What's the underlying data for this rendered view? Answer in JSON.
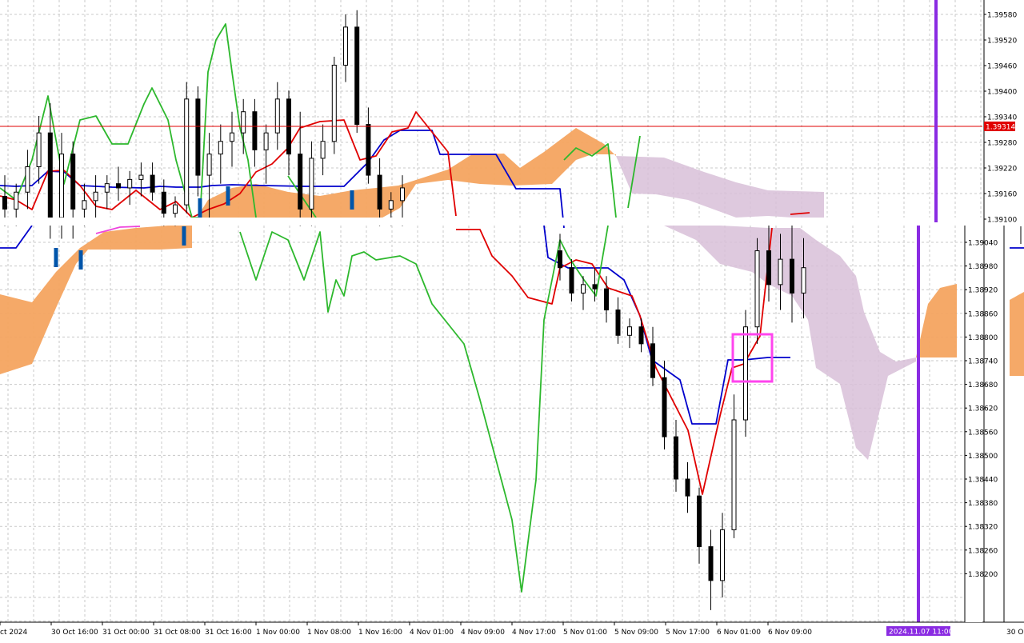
{
  "chart_data": {
    "type": "candlestick",
    "title": "",
    "ylim": [
      1.3816,
      1.3961
    ],
    "y_ticks": [
      "1.39580",
      "1.39520",
      "1.39460",
      "1.39400",
      "1.39340",
      "1.39280",
      "1.39220",
      "1.39160",
      "1.39100",
      "1.39040",
      "1.38980",
      "1.38920",
      "1.38860",
      "1.38800",
      "1.38740",
      "1.38680",
      "1.38620",
      "1.38560",
      "1.38500",
      "1.38440",
      "1.38380",
      "1.38320",
      "1.38260",
      "1.38200"
    ],
    "x_ticks": [
      "ct 2024",
      "30 Oct 16:00",
      "31 Oct 00:00",
      "31 Oct 08:00",
      "31 Oct 16:00",
      "1 Nov 00:00",
      "1 Nov 08:00",
      "1 Nov 16:00",
      "4 Nov 01:00",
      "4 Nov 09:00",
      "4 Nov 17:00",
      "5 Nov 01:00",
      "5 Nov 09:00",
      "5 Nov 17:00",
      "6 Nov 01:00",
      "6 Nov 09:00"
    ],
    "right_panel_tick": "30 O",
    "current_price": "1.39314",
    "vline_label": "2024.11.07 11:00",
    "grid": true,
    "colors": {
      "bull_candle": "#000000",
      "bear_candle": "#000000",
      "tenkan": "#e00000",
      "kijun": "#0000cc",
      "chikou": "#2db82d",
      "kumo_up": "#f4a460",
      "kumo_down": "#d8bfd8",
      "price_line": "#e00000",
      "highlight_box": "#ff44ee",
      "vline": "#8a2be2",
      "tick_highlight": "#0055aa"
    },
    "panels": [
      {
        "name": "upper",
        "ylim": [
          1.3908,
          1.3961
        ],
        "candles": [
          [
            1.3915,
            1.392,
            1.3908,
            1.3912
          ],
          [
            1.3912,
            1.3918,
            1.3908,
            1.3916
          ],
          [
            1.3916,
            1.3926,
            1.3912,
            1.3922
          ],
          [
            1.3922,
            1.3934,
            1.3918,
            1.393
          ],
          [
            1.393,
            1.3937,
            1.3905,
            1.391
          ],
          [
            1.391,
            1.393,
            1.3905,
            1.3925
          ],
          [
            1.3925,
            1.3928,
            1.3905,
            1.3912
          ],
          [
            1.3912,
            1.3918,
            1.3908,
            1.3914
          ],
          [
            1.3914,
            1.392,
            1.391,
            1.3916
          ],
          [
            1.3916,
            1.392,
            1.3912,
            1.3918
          ],
          [
            1.3918,
            1.3922,
            1.3914,
            1.3917
          ],
          [
            1.3917,
            1.3921,
            1.3913,
            1.3919
          ],
          [
            1.3919,
            1.3923,
            1.3915,
            1.392
          ],
          [
            1.392,
            1.3923,
            1.3914,
            1.3916
          ],
          [
            1.3916,
            1.3919,
            1.3908,
            1.3911
          ],
          [
            1.3911,
            1.3915,
            1.3908,
            1.3913
          ],
          [
            1.3913,
            1.3942,
            1.3911,
            1.3938
          ],
          [
            1.3938,
            1.3941,
            1.3915,
            1.392
          ],
          [
            1.392,
            1.393,
            1.3908,
            1.3925
          ],
          [
            1.3925,
            1.3932,
            1.3918,
            1.3928
          ],
          [
            1.3928,
            1.3935,
            1.3922,
            1.393
          ],
          [
            1.393,
            1.3938,
            1.3925,
            1.3935
          ],
          [
            1.3935,
            1.3938,
            1.3922,
            1.3926
          ],
          [
            1.3926,
            1.3932,
            1.3918,
            1.393
          ],
          [
            1.393,
            1.3942,
            1.3926,
            1.3938
          ],
          [
            1.3938,
            1.394,
            1.392,
            1.3925
          ],
          [
            1.3925,
            1.3935,
            1.3908,
            1.3912
          ],
          [
            1.3912,
            1.3928,
            1.3908,
            1.3924
          ],
          [
            1.3924,
            1.3932,
            1.392,
            1.3928
          ],
          [
            1.3928,
            1.3948,
            1.3925,
            1.3946
          ],
          [
            1.3946,
            1.3958,
            1.3942,
            1.3955
          ],
          [
            1.3955,
            1.3959,
            1.393,
            1.3932
          ],
          [
            1.3932,
            1.3936,
            1.3918,
            1.392
          ],
          [
            1.392,
            1.3924,
            1.3908,
            1.3912
          ],
          [
            1.3912,
            1.3916,
            1.3908,
            1.3914
          ],
          [
            1.3914,
            1.392,
            1.3908,
            1.3917
          ]
        ]
      },
      {
        "name": "lower",
        "ylim": [
          1.3816,
          1.3909
        ],
        "candles": [
          [
            1.3902,
            1.3906,
            1.3895,
            1.3898
          ],
          [
            1.3898,
            1.39,
            1.389,
            1.3892
          ],
          [
            1.3892,
            1.3896,
            1.3888,
            1.3894
          ],
          [
            1.3894,
            1.3898,
            1.389,
            1.3893
          ],
          [
            1.3893,
            1.3896,
            1.3885,
            1.3888
          ],
          [
            1.3888,
            1.3891,
            1.388,
            1.3882
          ],
          [
            1.3882,
            1.3886,
            1.3879,
            1.3884
          ],
          [
            1.3884,
            1.3886,
            1.3878,
            1.388
          ],
          [
            1.388,
            1.3884,
            1.387,
            1.3872
          ],
          [
            1.3872,
            1.3876,
            1.3855,
            1.3858
          ],
          [
            1.3858,
            1.3862,
            1.3845,
            1.3848
          ],
          [
            1.3848,
            1.3852,
            1.384,
            1.3844
          ],
          [
            1.3844,
            1.3846,
            1.3828,
            1.3832
          ],
          [
            1.3832,
            1.3836,
            1.3817,
            1.3824
          ],
          [
            1.3824,
            1.384,
            1.382,
            1.3836
          ],
          [
            1.3836,
            1.3868,
            1.3834,
            1.3862
          ],
          [
            1.3862,
            1.3888,
            1.3858,
            1.3884
          ],
          [
            1.3884,
            1.3905,
            1.388,
            1.3902
          ],
          [
            1.3902,
            1.3908,
            1.389,
            1.3894
          ],
          [
            1.3894,
            1.3906,
            1.3888,
            1.39
          ],
          [
            1.39,
            1.3909,
            1.3885,
            1.3892
          ],
          [
            1.3892,
            1.3905,
            1.3886,
            1.3898
          ]
        ]
      }
    ]
  }
}
